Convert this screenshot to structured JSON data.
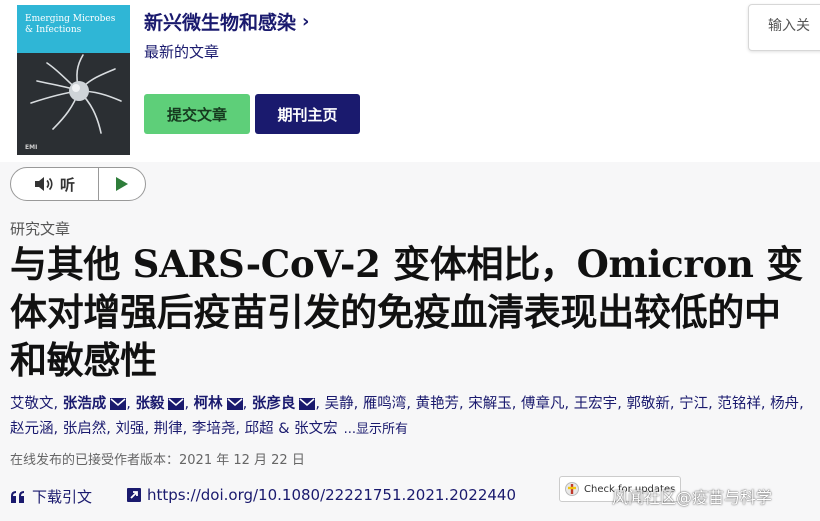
{
  "journal": {
    "name": "新兴微生物和感染",
    "latest_label": "最新的文章",
    "submit_label": "提交文章",
    "homepage_label": "期刊主页",
    "cover_title": "Emerging Microbes & Infections",
    "cover_footer": "EMI"
  },
  "search": {
    "placeholder": "输入关"
  },
  "listen": {
    "label": "听",
    "speaker_icon": "speaker-icon",
    "play_icon": "play-icon"
  },
  "article": {
    "type": "研究文章",
    "title": "与其他 SARS-CoV-2 变体相比，Omicron 变体对增强后疫苗引发的免疫血清表现出较低的中和敏感性",
    "authors": [
      {
        "name": "艾敬文",
        "bold": false,
        "mail": false
      },
      {
        "name": "张浩成",
        "bold": true,
        "mail": true
      },
      {
        "name": "张毅",
        "bold": true,
        "mail": true
      },
      {
        "name": "柯林",
        "bold": true,
        "mail": true
      },
      {
        "name": "张彦良",
        "bold": true,
        "mail": true
      },
      {
        "name": "吴静",
        "bold": false,
        "mail": false
      },
      {
        "name": "雁鸣湾",
        "bold": false,
        "mail": false
      },
      {
        "name": "黄艳芳",
        "bold": false,
        "mail": false
      },
      {
        "name": "宋解玉",
        "bold": false,
        "mail": false
      },
      {
        "name": "傅章凡",
        "bold": false,
        "mail": false
      },
      {
        "name": "王宏宇",
        "bold": false,
        "mail": false
      },
      {
        "name": "郭敬新",
        "bold": false,
        "mail": false
      },
      {
        "name": "宁江",
        "bold": false,
        "mail": false
      },
      {
        "name": "范铭祥",
        "bold": false,
        "mail": false
      },
      {
        "name": "杨舟",
        "bold": false,
        "mail": false
      },
      {
        "name": "赵元涵",
        "bold": false,
        "mail": false
      },
      {
        "name": "张启然",
        "bold": false,
        "mail": false
      },
      {
        "name": "刘强",
        "bold": false,
        "mail": false
      },
      {
        "name": "荆律",
        "bold": false,
        "mail": false
      },
      {
        "name": "李培尧",
        "bold": false,
        "mail": false
      },
      {
        "name": "邱超",
        "bold": false,
        "mail": false
      },
      {
        "name": "张文宏",
        "bold": false,
        "mail": false
      }
    ],
    "show_all_label": "...显示所有",
    "published": "在线发布的已接受作者版本：2021 年 12 月 22 日",
    "cite_label": "下载引文",
    "doi": "https://doi.org/10.1080/22221751.2021.2022440",
    "check_updates_label": "Check for updates"
  },
  "watermark": "风闻社区@疫苗与科学",
  "colors": {
    "navy": "#1a1a6e",
    "green": "#5ecf79",
    "cover_band": "#2fb6d6"
  }
}
